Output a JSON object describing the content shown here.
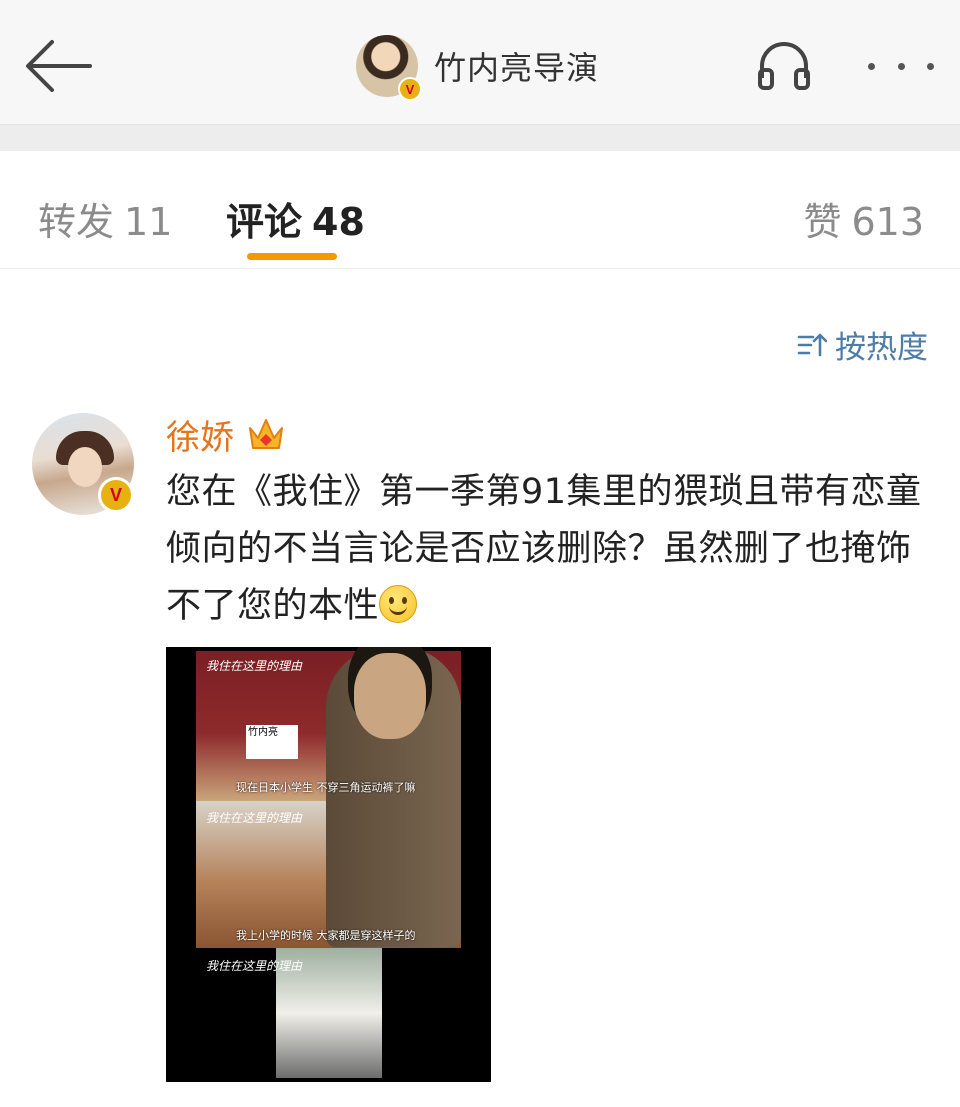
{
  "header": {
    "title": "竹内亮导演",
    "avatar_badge": "V",
    "icons": {
      "back": "back-arrow-icon",
      "listen": "headphones-icon",
      "more": "more-dots-icon"
    }
  },
  "tabs": [
    {
      "label": "转发",
      "count": "11"
    },
    {
      "label": "评论",
      "count": "48",
      "active": true
    },
    {
      "label": "赞",
      "count": "613"
    }
  ],
  "sort": {
    "label": "按热度",
    "icon": "sort-icon"
  },
  "comment": {
    "username": "徐娇",
    "badge": "V",
    "member_icon": "crown-icon",
    "text": "您在《我住》第一季第91集里的猥琐且带有恋童倾向的不当言论是否应该删除？虽然删了也掩饰不了您的本性",
    "emoji": "smile-emoji",
    "image": {
      "captions": [
        "现在日本小学生 不穿三角运动裤了嘛",
        "我上小学的时候 大家都是穿这样子的"
      ],
      "name_card": "竹内亮"
    }
  },
  "colors": {
    "accent": "#f29a00",
    "username": "#e8731a",
    "link": "#4e7ca8"
  }
}
